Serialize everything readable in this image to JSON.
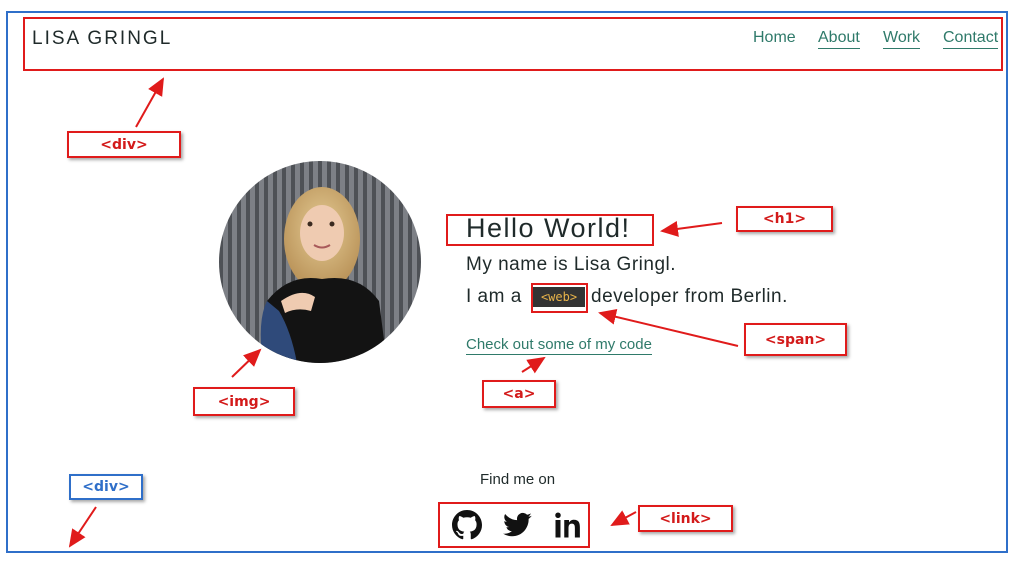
{
  "header": {
    "brand": "LISA GRINGL",
    "nav": [
      {
        "label": "Home"
      },
      {
        "label": "About"
      },
      {
        "label": "Work"
      },
      {
        "label": "Contact"
      }
    ]
  },
  "hero": {
    "title": "Hello World!",
    "line1": "My name is Lisa Gringl.",
    "line2_prefix": "I am a",
    "web_tag": "<web>",
    "line2_suffix": "developer from Berlin.",
    "code_link": "Check out some of my code"
  },
  "footer": {
    "find_me": "Find me on",
    "socials": [
      "github-icon",
      "twitter-icon",
      "linkedin-icon"
    ]
  },
  "annotations": {
    "header_div": "<div>",
    "h1": "<h1>",
    "span": "<span>",
    "img": "<img>",
    "a": "<a>",
    "footer_div": "<div>",
    "link": "<link>"
  },
  "colors": {
    "annotation_red": "#e01b1b",
    "annotation_blue": "#2f6fc9",
    "link_green": "#2f7a6a",
    "text_dark": "#1f2a2a",
    "span_bg": "#333333",
    "span_text": "#e8b34a"
  }
}
